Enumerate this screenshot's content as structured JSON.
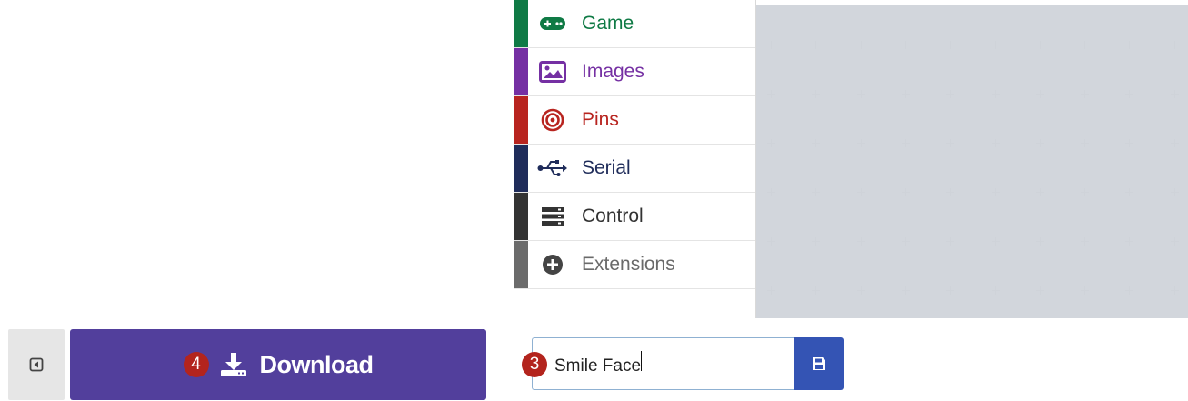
{
  "toolbox": {
    "categories": [
      {
        "label": "Game",
        "icon": "gamepad-icon",
        "color": "#0f7a45",
        "stripe": "#0f7a45"
      },
      {
        "label": "Images",
        "icon": "image-icon",
        "color": "#7530a3",
        "stripe": "#7530a3"
      },
      {
        "label": "Pins",
        "icon": "target-icon",
        "color": "#b8241f",
        "stripe": "#b8241f"
      },
      {
        "label": "Serial",
        "icon": "usb-icon",
        "color": "#1f2c5a",
        "stripe": "#1f2c5a"
      },
      {
        "label": "Control",
        "icon": "server-icon",
        "color": "#333333",
        "stripe": "#333333"
      },
      {
        "label": "Extensions",
        "icon": "plus-circle-icon",
        "color": "#6a6a6a",
        "stripe": "#6b6b6b"
      }
    ]
  },
  "bottom_bar": {
    "download_label": "Download",
    "download_badge": "4",
    "name_badge": "3",
    "project_name": "Smile Face"
  },
  "colors": {
    "download_bg": "#523f9c",
    "save_bg": "#3454b4",
    "badge": "#b3241d",
    "workspace_bg": "#e8ebef"
  }
}
